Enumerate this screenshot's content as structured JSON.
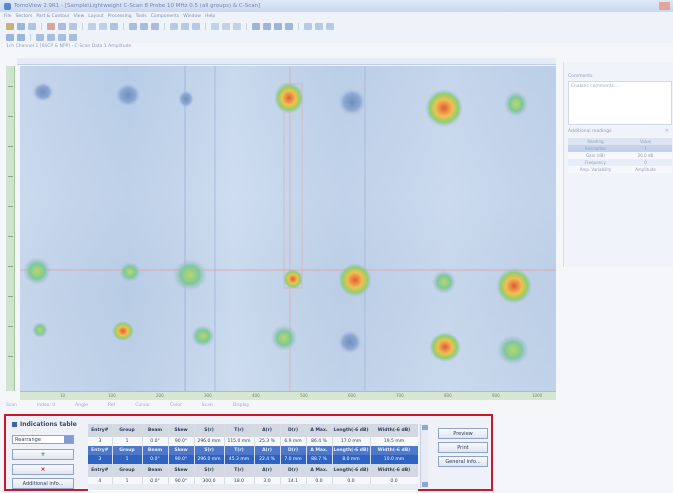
{
  "window": {
    "title": "TomoView 2.9R1 - [Sample\\Lightweight C-Scan 8 Probe 10 MHz 0.5 (all groups) & C-Scan]"
  },
  "menubar": [
    "File",
    "Sectors",
    "Part & Contour",
    "View",
    "Layout",
    "Processing",
    "Tools",
    "Components",
    "Window",
    "Help"
  ],
  "subtitle": "1ch Channel 1 [6SCP & NPP] - C-Scan Data 1 Amplitude",
  "ruler_bottom": [
    "10",
    "100",
    "200",
    "300",
    "400",
    "500",
    "600",
    "700",
    "800",
    "900",
    "1000"
  ],
  "statusbar": [
    "Scan",
    "Index: 0",
    "Angle",
    "Ref",
    "Cursor",
    "Color",
    "Scan",
    "Display"
  ],
  "right_panel": {
    "comments_label": "Comments:",
    "comments_text": "Enables comments...",
    "readings_label": "Additional readings",
    "close": "✕",
    "readings": [
      {
        "reading": "Reading",
        "value": "Value"
      },
      {
        "reading": "Resolution",
        "value": "1"
      },
      {
        "reading": "Gain (dB)",
        "value": "26.0 dB"
      },
      {
        "reading": "Frequency",
        "value": "0"
      },
      {
        "reading": "Amp. Variability",
        "value": "Amplitude"
      }
    ]
  },
  "indications": {
    "title": "Indications table",
    "select_value": "Rearrange",
    "add_label": "+",
    "delete_label": "×",
    "additional_info_label": "Additional info...",
    "preview_label": "Preview",
    "print_label": "Print",
    "general_info_label": "General info...",
    "columns": [
      "Entry#",
      "Group",
      "Beam",
      "Skew",
      "S(r)",
      "T(r)",
      "A(r)",
      "D(r)",
      "A Max.",
      "Length(-6 dB)",
      "Width(-6 dB)"
    ],
    "rows": [
      {
        "type": "h",
        "cells": [
          "Entry#",
          "Group",
          "Beam",
          "Skew",
          "S(r)",
          "T(r)",
          "A(r)",
          "D(r)",
          "A Max.",
          "Length(-6 dB)",
          "Width(-6 dB)"
        ]
      },
      {
        "type": "d",
        "cells": [
          "3",
          "1",
          "0.0°",
          "90.0°",
          "296.0 mm",
          "115.0 mm",
          "25.3 %",
          "6.9 mm",
          "86.4 %",
          "17.0 mm",
          "19.5 mm"
        ]
      },
      {
        "type": "s",
        "cells": [
          "Entry#",
          "Group",
          "Beam",
          "Skew",
          "S(r)",
          "T(r)",
          "A(r)",
          "D(r)",
          "A Max.",
          "Length(-6 dB)",
          "Width(-6 dB)"
        ]
      },
      {
        "type": "sd",
        "cells": [
          "3",
          "1",
          "0.0°",
          "90.0°",
          "296.0 mm",
          "45.3 mm",
          "22.4 %",
          "7.0 mm",
          "88.7 %",
          "8.0 mm",
          "10.0 mm"
        ]
      },
      {
        "type": "h",
        "cells": [
          "Entry#",
          "Group",
          "Beam",
          "Skew",
          "S(r)",
          "T(r)",
          "A(r)",
          "D(r)",
          "A Max.",
          "Length(-6 dB)",
          "Width(-6 dB)"
        ]
      },
      {
        "type": "d",
        "cells": [
          "4",
          "1",
          "0.0°",
          "90.0°",
          "300.0",
          "18.0",
          "3.0",
          "14.1",
          "0.0",
          "0.0",
          "0.0"
        ]
      }
    ]
  },
  "colors": {
    "accent": "#c8182c",
    "selection": "#2e63c1"
  }
}
